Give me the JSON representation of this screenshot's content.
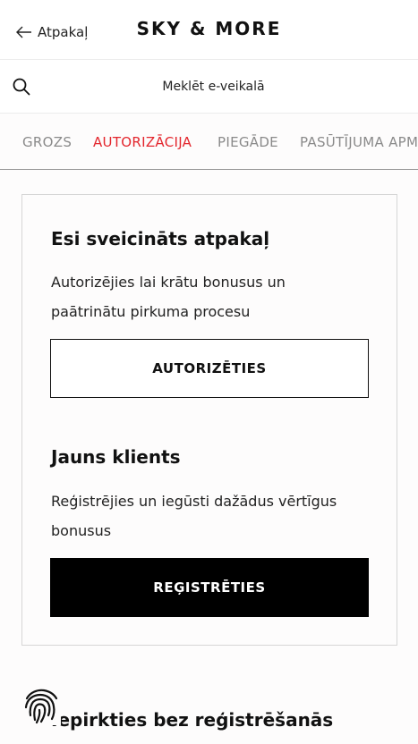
{
  "header": {
    "back_label": "Atpakaļ",
    "logo_text": "SKY & MORE"
  },
  "search": {
    "placeholder": "Meklēt e-veikalā",
    "icon": "search-icon"
  },
  "steps": {
    "items": [
      {
        "label": "GROZS",
        "active": false
      },
      {
        "label": "AUTORIZĀCIJA",
        "active": true
      },
      {
        "label": "PIEGĀDE",
        "active": false
      },
      {
        "label": "PASŪTĪJUMA APM",
        "active": false
      }
    ],
    "active_color": "#e3262d",
    "inactive_color": "#8a8a8a"
  },
  "login": {
    "title": "Esi sveicināts atpakaļ",
    "text": "Autorizējies lai krātu bonusus un paātrinātu pirkuma procesu",
    "button_label": "AUTORIZĒTIES"
  },
  "register": {
    "title": "Jauns klients",
    "text": "Reģistrējies un iegūsti dažādus vērtīgus bonusus",
    "button_label": "REĢISTRĒTIES"
  },
  "guest": {
    "title": "Iepirkties bez reģistrēšanās"
  },
  "fingerprint": {
    "icon": "fingerprint-icon"
  }
}
